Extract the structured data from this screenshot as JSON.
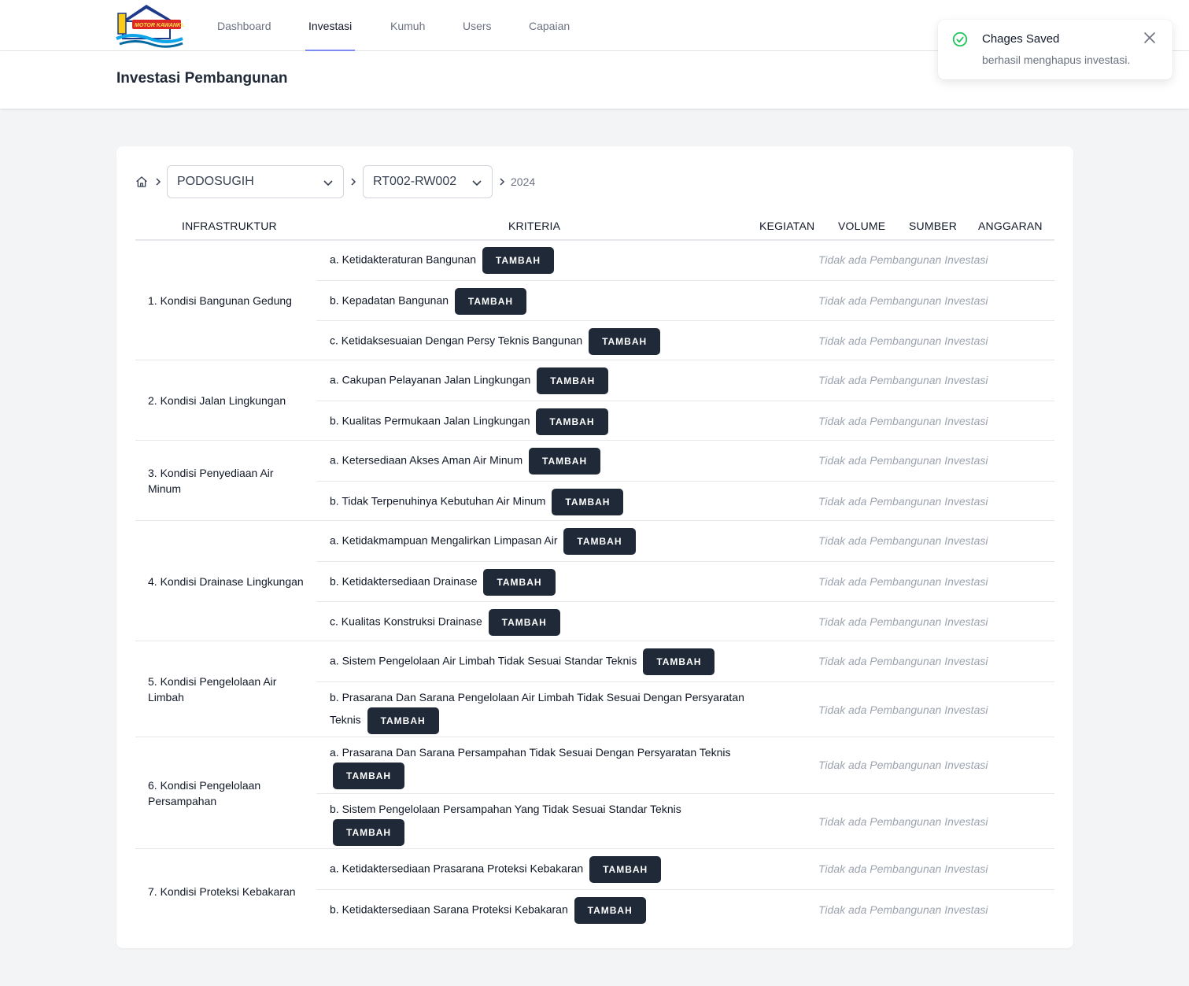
{
  "nav": {
    "logo_text": "MOTOR KAWANKU",
    "links": [
      {
        "label": "Dashboard"
      },
      {
        "label": "Investasi"
      },
      {
        "label": "Kumuh"
      },
      {
        "label": "Users"
      },
      {
        "label": "Capaian"
      }
    ]
  },
  "header": {
    "title": "Investasi Pembangunan"
  },
  "toast": {
    "title": "Chages Saved",
    "message": "berhasil menghapus investasi."
  },
  "filters": {
    "kelurahan": "PODOSUGIH",
    "rt_rw": "RT002-RW002",
    "year": "2024"
  },
  "table": {
    "headers": {
      "infrastruktur": "INFRASTRUKTUR",
      "kriteria": "KRITERIA",
      "kegiatan": "KEGIATAN",
      "volume": "VOLUME",
      "sumber": "SUMBER",
      "anggaran": "ANGGARAN"
    },
    "button_label": "TAMBAH",
    "empty_text": "Tidak ada Pembangunan Investasi",
    "groups": [
      {
        "infrastruktur": "1. Kondisi Bangunan Gedung",
        "kriteria": [
          "a. Ketidakteraturan Bangunan",
          "b. Kepadatan Bangunan",
          "c. Ketidaksesuaian Dengan Persy Teknis Bangunan"
        ]
      },
      {
        "infrastruktur": "2. Kondisi Jalan Lingkungan",
        "kriteria": [
          "a. Cakupan Pelayanan Jalan Lingkungan",
          "b. Kualitas Permukaan Jalan Lingkungan"
        ]
      },
      {
        "infrastruktur": "3. Kondisi Penyediaan Air Minum",
        "kriteria": [
          "a. Ketersediaan Akses Aman Air Minum",
          "b. Tidak Terpenuhinya Kebutuhan Air Minum"
        ]
      },
      {
        "infrastruktur": "4. Kondisi Drainase Lingkungan",
        "kriteria": [
          "a. Ketidakmampuan Mengalirkan Limpasan Air",
          "b. Ketidaktersediaan Drainase",
          "c. Kualitas Konstruksi Drainase"
        ]
      },
      {
        "infrastruktur": "5. Kondisi Pengelolaan Air Limbah",
        "kriteria": [
          "a. Sistem Pengelolaan Air Limbah Tidak Sesuai Standar Teknis",
          "b. Prasarana Dan Sarana Pengelolaan Air Limbah Tidak Sesuai Dengan Persyaratan Teknis"
        ]
      },
      {
        "infrastruktur": "6. Kondisi Pengelolaan Persampahan",
        "kriteria": [
          "a. Prasarana Dan Sarana Persampahan Tidak Sesuai Dengan Persyaratan Teknis",
          "b. Sistem Pengelolaan Persampahan Yang Tidak Sesuai Standar Teknis"
        ]
      },
      {
        "infrastruktur": "7. Kondisi Proteksi Kebakaran",
        "kriteria": [
          "a. Ketidaktersediaan Prasarana Proteksi Kebakaran",
          "b. Ketidaktersediaan Sarana Proteksi Kebakaran"
        ]
      }
    ]
  },
  "colors": {
    "primary_button": "#1f2937",
    "active_tab_underline": "#818cf8",
    "success_icon": "#22c55e",
    "background": "#f3f4f6"
  }
}
